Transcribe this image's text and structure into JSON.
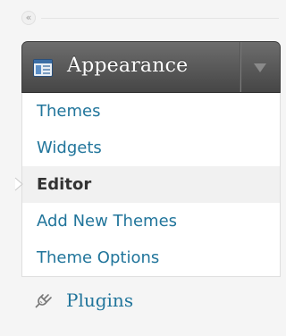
{
  "collapse": {
    "glyph": "«"
  },
  "menu": {
    "title": "Appearance",
    "icon": "appearance-window-icon",
    "toggle_icon": "triangle-down-icon",
    "items": [
      {
        "label": "Themes",
        "current": false
      },
      {
        "label": "Widgets",
        "current": false
      },
      {
        "label": "Editor",
        "current": true
      },
      {
        "label": "Add New Themes",
        "current": false
      },
      {
        "label": "Theme Options",
        "current": false
      }
    ]
  },
  "next_menu": {
    "title": "Plugins",
    "icon": "plug-icon"
  },
  "colors": {
    "link": "#21759b",
    "current_text": "#333333",
    "header_bg": "#464646",
    "page_bg": "#f5f5f5"
  }
}
